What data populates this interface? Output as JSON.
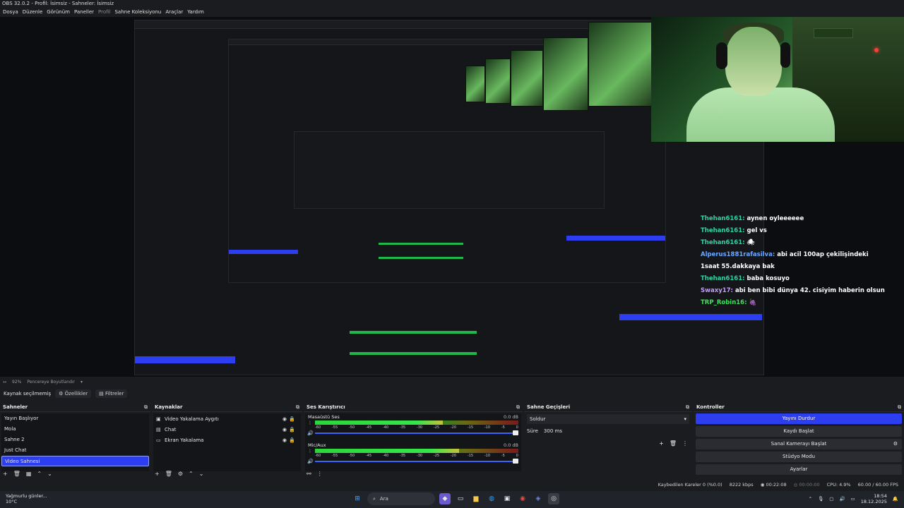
{
  "window": {
    "title": "OBS 32.0.2 - Profil: İsimsiz - Sahneler: İsimsiz"
  },
  "menu": [
    "Dosya",
    "Düzenle",
    "Görünüm",
    "Paneller",
    "Profil",
    "Sahne Koleksiyonu",
    "Araçlar",
    "Yardım"
  ],
  "chat": [
    {
      "user": "Thehan6161:",
      "text": "aynen oyleeeeee",
      "color": "#2fd3a4"
    },
    {
      "user": "Thehan6161:",
      "text": "gel vs",
      "color": "#2fd3a4"
    },
    {
      "user": "Thehan6161:",
      "text": "🕷",
      "color": "#2fd3a4"
    },
    {
      "user": "Alperus1881rafasilva:",
      "text": "abi acil 100ap çekilişindeki 1saat 55.dakkaya bak",
      "color": "#6aa8ff"
    },
    {
      "user": "Thehan6161:",
      "text": "baba kosuyo",
      "color": "#2fd3a4"
    },
    {
      "user": "Swaxy17:",
      "text": "abi ben bibi dünya 42. cisiyim haberin olsun",
      "color": "#c49bff"
    },
    {
      "user": "TRP_Robin16:",
      "text": "🍇",
      "color": "#3fe05a"
    }
  ],
  "zoom": {
    "percent": "92%",
    "mode": "Pencereye Boyutlandır"
  },
  "status": {
    "no_source": "Kaynak seçilmemiş",
    "properties": "Özellikler",
    "filters": "Filtreler"
  },
  "scenes": {
    "title": "Sahneler",
    "items": [
      "Yayın Başlıyor",
      "Mola",
      "Sahne 2",
      "Just Chat",
      "Video Sahnesi"
    ],
    "selected": "Video Sahnesi"
  },
  "sources": {
    "title": "Kaynaklar",
    "items": [
      {
        "label": "Video Yakalama Aygıtı",
        "icon": "camera-icon"
      },
      {
        "label": "Chat",
        "icon": "chat-icon"
      },
      {
        "label": "Ekran Yakalama",
        "icon": "monitor-icon"
      }
    ]
  },
  "mixer": {
    "title": "Ses Karıştırıcı",
    "channels": [
      {
        "name": "Masaüstü Ses",
        "db": "0.0 dB",
        "level": 0.63
      },
      {
        "name": "Mic/Aux",
        "db": "0.0 dB",
        "level": 0.71
      }
    ],
    "ticks": [
      "-60",
      "-55",
      "-50",
      "-45",
      "-40",
      "-35",
      "-30",
      "-25",
      "-20",
      "-15",
      "-10",
      "-5",
      "0"
    ]
  },
  "transitions": {
    "title": "Sahne Geçişleri",
    "type": "Soldur",
    "duration_label": "Süre",
    "duration": "300 ms"
  },
  "controls": {
    "title": "Kontroller",
    "buttons": [
      "Yayını Durdur",
      "Kaydı Başlat",
      "Sanal Kamerayı Başlat",
      "Stüdyo Modu",
      "Ayarlar"
    ]
  },
  "footer": {
    "dropped": "Kaybedilen Kareler 0 (%0.0)",
    "bitrate": "8222 kbps",
    "stream_time": "00:22:08",
    "rec_time": "00:00:00",
    "cpu": "CPU: 4.9%",
    "fps": "60.00 / 60.00 FPS"
  },
  "taskbar": {
    "weather_title": "Yağmurlu günler...",
    "weather_temp": "10°C",
    "search": "Ara",
    "time": "18:54",
    "date": "18.12.2025"
  },
  "colors": {
    "accent": "#2c3ef0",
    "meter_green": "#2bd63a",
    "background": "#1b1c1f"
  }
}
